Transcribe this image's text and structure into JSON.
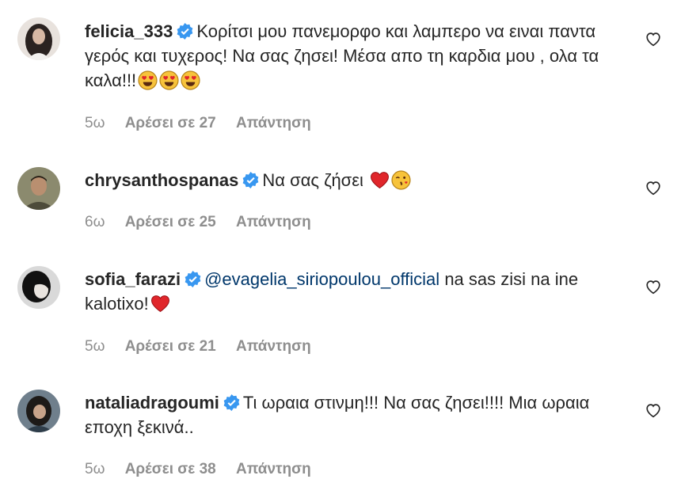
{
  "colors": {
    "text": "#262626",
    "secondary": "#8e8e8e",
    "mention": "#00376b",
    "verified_badge": "#3897f0"
  },
  "comments": [
    {
      "username": "felicia_333",
      "verified": true,
      "text_parts": [
        "Κορίτσι μου πανεμορφο και λαμπερο να ειναι παντα γερός και τυχερος! Να σας ζησει! Μέσα απο τη καρδια μου , ολα τα καλα!!!"
      ],
      "emojis": [
        "heart-eyes-emoji",
        "heart-eyes-emoji",
        "heart-eyes-emoji"
      ],
      "time": "5ω",
      "likes": "Αρέσει σε 27",
      "reply": "Απάντηση"
    },
    {
      "username": "chrysanthospanas",
      "verified": true,
      "text_parts": [
        "Να σας ζήσει"
      ],
      "emojis": [
        "red-heart-emoji",
        "kissing-wink-emoji"
      ],
      "time": "6ω",
      "likes": "Αρέσει σε 25",
      "reply": "Απάντηση"
    },
    {
      "username": "sofia_farazi",
      "verified": true,
      "mention": "@evagelia_siriopoulou_official",
      "text_parts": [
        "na sas zisi na ine kalotixo!"
      ],
      "emojis": [
        "red-heart-emoji"
      ],
      "time": "5ω",
      "likes": "Αρέσει σε 21",
      "reply": "Απάντηση"
    },
    {
      "username": "nataliadragoumi",
      "verified": true,
      "text_parts": [
        "Τι ωραια στινμη!!! Να σας ζησει!!!! Μια ωραια εποχη ξεκινά.."
      ],
      "emojis": [],
      "time": "5ω",
      "likes": "Αρέσει σε 38",
      "reply": "Απάντηση"
    }
  ]
}
